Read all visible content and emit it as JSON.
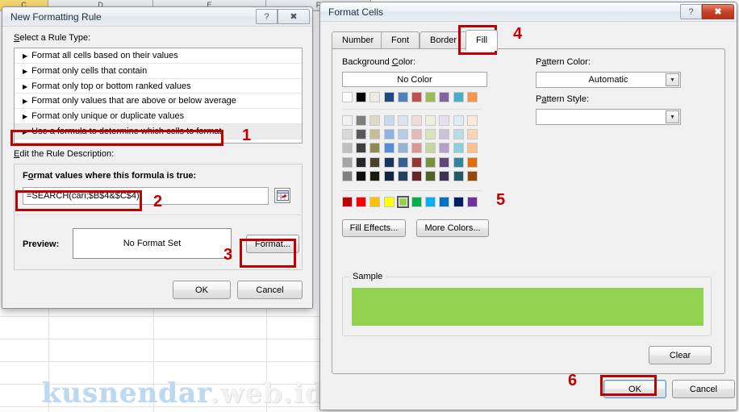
{
  "backdrop": {
    "columns": [
      {
        "label": "C",
        "selected": true
      },
      {
        "label": "D",
        "selected": false
      },
      {
        "label": "E",
        "selected": false
      },
      {
        "label": "F",
        "selected": false
      }
    ],
    "watermark_part1": "kusnendar",
    "watermark_part2": ".web.id"
  },
  "new_rule_dialog": {
    "title": "New Formatting Rule",
    "help_icon": "question-mark-icon",
    "close_icon": "close-x-icon",
    "select_rule_label": "Select a Rule Type:",
    "rule_types": [
      {
        "label": "Format all cells based on their values",
        "selected": false
      },
      {
        "label": "Format only cells that contain",
        "selected": false
      },
      {
        "label": "Format only top or bottom ranked values",
        "selected": false
      },
      {
        "label": "Format only values that are above or below average",
        "selected": false
      },
      {
        "label": "Format only unique or duplicate values",
        "selected": false
      },
      {
        "label": "Use a formula to determine which cells to format",
        "selected": true
      }
    ],
    "edit_desc_label": "Edit the Rule Description:",
    "formula_label": "Format values where this formula is true:",
    "formula_value": "=SEARCH(cari;$B$4&$C$4)",
    "range_picker_icon": "range-select-icon",
    "preview_label": "Preview:",
    "preview_value": "No Format Set",
    "format_button": "Format...",
    "ok_button": "OK",
    "cancel_button": "Cancel"
  },
  "format_cells_dialog": {
    "title": "Format Cells",
    "help_icon": "question-mark-icon",
    "close_icon": "close-x-icon",
    "tabs": [
      {
        "label": "Number",
        "active": false
      },
      {
        "label": "Font",
        "active": false
      },
      {
        "label": "Border",
        "active": false
      },
      {
        "label": "Fill",
        "active": true
      }
    ],
    "background_color_label": "Background Color:",
    "no_color_button": "No Color",
    "pattern_color_label": "Pattern Color:",
    "pattern_color_value": "Automatic",
    "pattern_style_label": "Pattern Style:",
    "pattern_style_value": "",
    "dropdown_icon": "chevron-down-icon",
    "fill_effects_button": "Fill Effects...",
    "more_colors_button": "More Colors...",
    "sample_label": "Sample",
    "sample_color": "#92d050",
    "clear_button": "Clear",
    "ok_button": "OK",
    "cancel_button": "Cancel",
    "palette": {
      "theme_row": [
        "#ffffff",
        "#000000",
        "#eeece1",
        "#1f497d",
        "#4f81bd",
        "#c0504d",
        "#9bbb59",
        "#8064a2",
        "#4bacc6",
        "#f79646"
      ],
      "tint_rows": [
        [
          "#f2f2f2",
          "#7f7f7f",
          "#ddd9c3",
          "#c6d9f0",
          "#dbe5f1",
          "#f2dcdb",
          "#ebf1dd",
          "#e5e0ec",
          "#dbeef3",
          "#fdeada"
        ],
        [
          "#d8d8d8",
          "#595959",
          "#c4bd97",
          "#8db3e2",
          "#b8cce4",
          "#e5b9b7",
          "#d7e3bc",
          "#ccc1d9",
          "#b7dde8",
          "#fbd5b5"
        ],
        [
          "#bfbfbf",
          "#3f3f3f",
          "#938953",
          "#548dd4",
          "#95b3d7",
          "#d99694",
          "#c3d69b",
          "#b2a2c7",
          "#92cddc",
          "#fac08f"
        ],
        [
          "#a5a5a5",
          "#262626",
          "#494429",
          "#17365d",
          "#366092",
          "#953734",
          "#76923c",
          "#5f497a",
          "#31859b",
          "#e36c0a"
        ],
        [
          "#7f7f7f",
          "#0c0c0c",
          "#1d1b10",
          "#0f243e",
          "#244061",
          "#632423",
          "#4f6128",
          "#3f3151",
          "#205867",
          "#974806"
        ]
      ],
      "standard_row": [
        "#c00000",
        "#ff0000",
        "#ffc000",
        "#ffff00",
        "#92d050",
        "#00b050",
        "#00b0f0",
        "#0070c0",
        "#002060",
        "#7030a0"
      ],
      "selected_standard_index": 4
    }
  },
  "annotations": [
    {
      "number": "1"
    },
    {
      "number": "2"
    },
    {
      "number": "3"
    },
    {
      "number": "4"
    },
    {
      "number": "5"
    },
    {
      "number": "6"
    }
  ]
}
